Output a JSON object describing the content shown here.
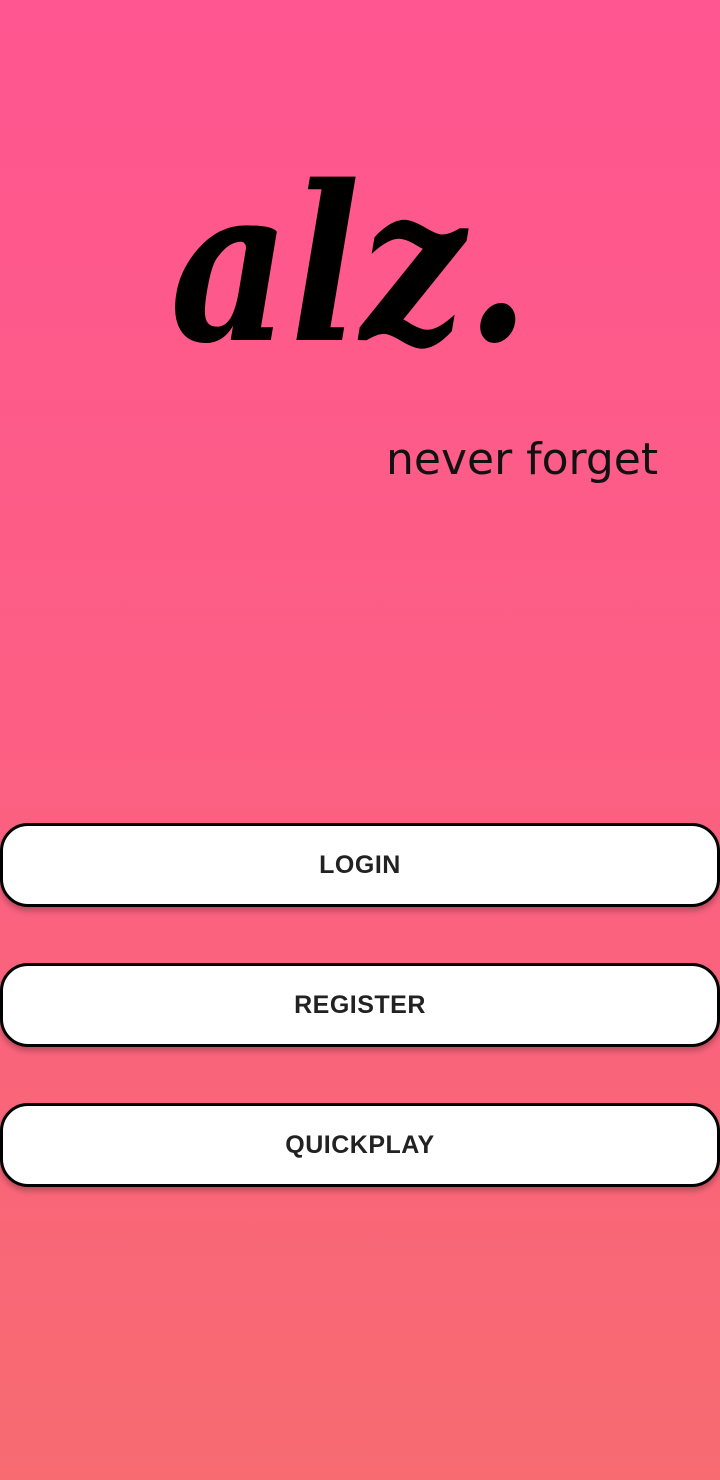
{
  "app": {
    "logo_text": "alz.",
    "tagline": "never forget"
  },
  "buttons": {
    "login_label": "LOGIN",
    "register_label": "REGISTER",
    "quickplay_label": "QUICKPLAY"
  },
  "colors": {
    "background_top": "#ff5591",
    "background_bottom": "#f76b71",
    "button_fill": "#ffffff",
    "button_border": "#000000",
    "text": "#111111"
  }
}
